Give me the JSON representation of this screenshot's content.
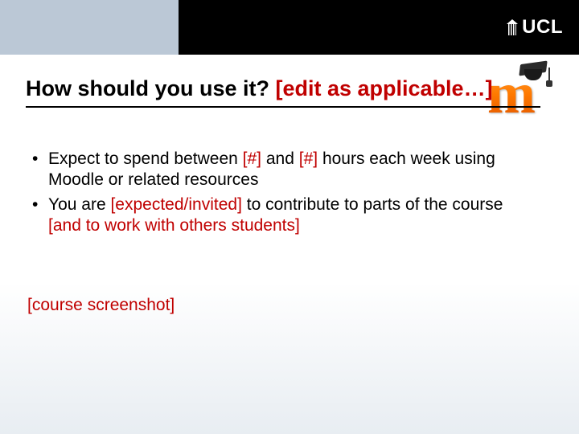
{
  "brand": {
    "logo_text": "UCL",
    "moodle_letter": "m"
  },
  "title": {
    "plain": "How should you use it? ",
    "editable": "[edit as applicable…]"
  },
  "bullets": [
    {
      "seg1": "Expect to spend between ",
      "ph1": "[#]",
      "seg2": " and ",
      "ph2": "[#]",
      "seg3": " hours each week using Moodle or related resources"
    },
    {
      "seg1": "You are ",
      "ph1": "[expected/invited]",
      "seg2": " to contribute to parts of the course ",
      "ph2": "[and to work with others students]",
      "seg3": ""
    }
  ],
  "placeholder": "[course screenshot]"
}
